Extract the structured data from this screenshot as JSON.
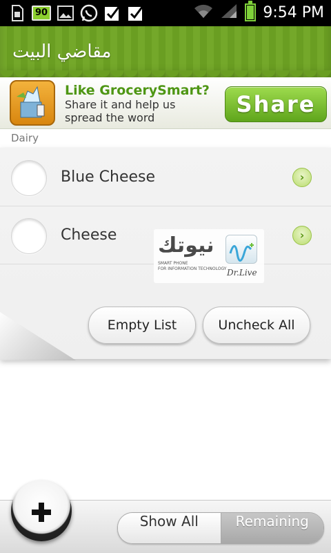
{
  "status_bar": {
    "battery_percent_badge": "90",
    "time": "9:54 PM",
    "icons": [
      "sd-card-icon",
      "battery-badge-icon",
      "image-icon",
      "whatsapp-icon",
      "check-box-icon",
      "check-box-icon",
      "wifi-icon",
      "signal-icon",
      "battery-icon"
    ]
  },
  "header": {
    "title": "مقاضي البيت"
  },
  "ad": {
    "headline": "Like GrocerySmart?",
    "line1": "Share it and help us",
    "line2": "spread the word",
    "button_label": "Share"
  },
  "list": {
    "category": "Dairy",
    "items": [
      {
        "label": "Blue Cheese",
        "checked": false
      },
      {
        "label": "Cheese",
        "checked": false
      }
    ],
    "chevron_glyph": "›"
  },
  "watermark": {
    "arabic_text": "نيوتك",
    "sub1": "SMART PHONE",
    "sub2": "FOR INFORMATION TECHNOLOGY",
    "signature": "Dr.Live"
  },
  "actions": {
    "empty_list": "Empty List",
    "uncheck_all": "Uncheck All"
  },
  "bottom": {
    "show_all": "Show All",
    "remaining": "Remaining",
    "selected": "Remaining"
  },
  "colors": {
    "header_green": "#6a9e22",
    "share_green": "#5fa51c",
    "ad_headline_green": "#4e9614"
  }
}
